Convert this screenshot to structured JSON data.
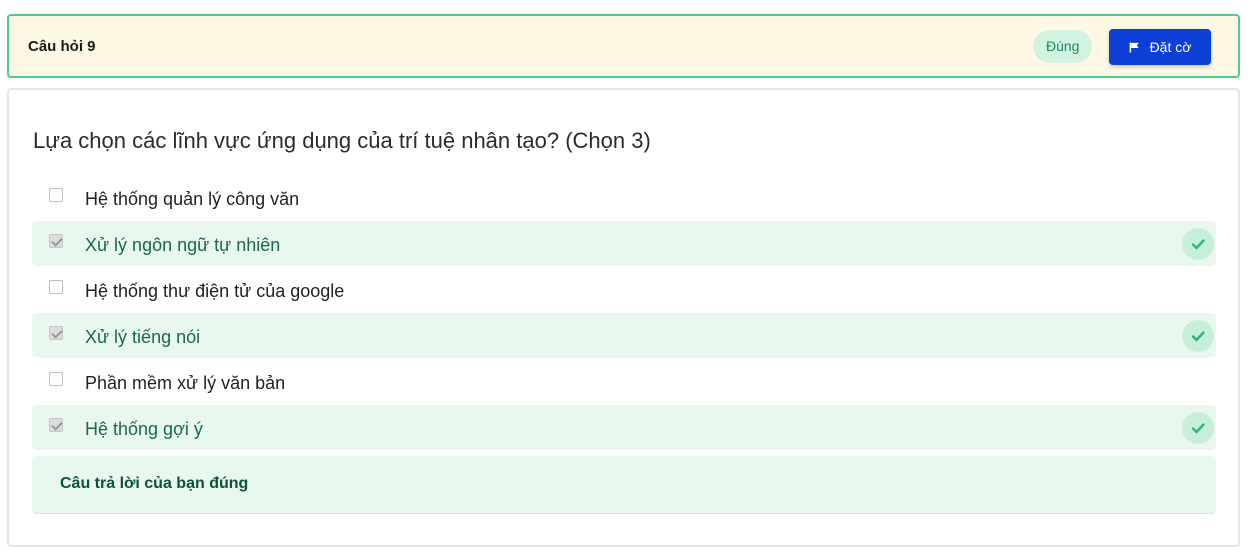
{
  "header": {
    "title": "Câu hỏi 9",
    "status": "Đúng",
    "flag_button_label": "Đặt cờ",
    "flag_icon": "flag-icon"
  },
  "question": {
    "text": "Lựa chọn các lĩnh vực ứng dụng của trí tuệ nhân tạo? (Chọn 3)"
  },
  "options": [
    {
      "label": "Hệ thống quản lý công văn",
      "checked": false,
      "correct": false
    },
    {
      "label": "Xử lý ngôn ngữ tự nhiên",
      "checked": true,
      "correct": true
    },
    {
      "label": "Hệ thống thư điện tử của google",
      "checked": false,
      "correct": false
    },
    {
      "label": "Xử lý tiếng nói",
      "checked": true,
      "correct": true
    },
    {
      "label": "Phần mềm xử lý văn bản",
      "checked": false,
      "correct": false
    },
    {
      "label": "Hệ thống gợi ý",
      "checked": true,
      "correct": true
    }
  ],
  "feedback": {
    "text": "Câu trả lời của bạn đúng"
  },
  "colors": {
    "header_bg": "#fef9e4",
    "header_border": "#4fcb8d",
    "status_bg": "#d2f2e2",
    "status_text": "#1f8a55",
    "flag_button_bg": "#0b3fd6",
    "correct_row_bg": "#e9f8ef",
    "correct_text": "#1a6a42",
    "check_circle_bg": "#c6efd9",
    "check_mark": "#2bb673",
    "feedback_text": "#0d5430"
  }
}
